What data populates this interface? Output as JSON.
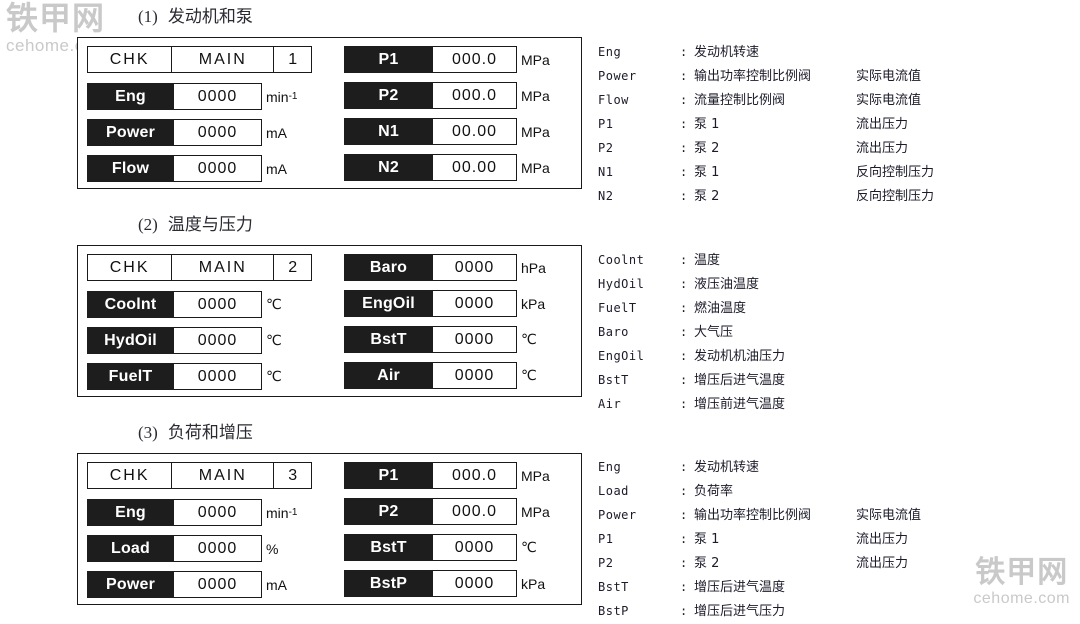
{
  "watermarks": {
    "top_left_cn": "铁甲网",
    "top_left_en": "cehome.com",
    "bottom_right_cn": "铁甲网",
    "bottom_right_en": "cehome.com"
  },
  "colors": {
    "label_background": "#1d1d1d",
    "label_text": "#ffffff",
    "panel_border": "#1a1a1a",
    "page_background": "#ffffff",
    "legend_text": "#1b1b2a",
    "watermark": "#c9c9c9"
  },
  "sections": [
    {
      "number": "(1)",
      "title": "发动机和泵",
      "panel": {
        "header": {
          "mode": "CHK",
          "menu": "MAIN",
          "page": "1"
        },
        "left_fields": [
          {
            "label": "Eng",
            "value": "0000",
            "unit": "min",
            "unit_sup": "-1"
          },
          {
            "label": "Power",
            "value": "0000",
            "unit": "mA",
            "unit_sup": ""
          },
          {
            "label": "Flow",
            "value": "0000",
            "unit": "mA",
            "unit_sup": ""
          }
        ],
        "right_fields": [
          {
            "label": "P1",
            "value": "000.0",
            "unit": "MPa",
            "unit_sup": ""
          },
          {
            "label": "P2",
            "value": "000.0",
            "unit": "MPa",
            "unit_sup": ""
          },
          {
            "label": "N1",
            "value": "00.00",
            "unit": "MPa",
            "unit_sup": ""
          },
          {
            "label": "N2",
            "value": "00.00",
            "unit": "MPa",
            "unit_sup": ""
          }
        ]
      },
      "legend": [
        {
          "key": "Eng",
          "colon": ":",
          "desc": "发动机转速",
          "extra": ""
        },
        {
          "key": "Power",
          "colon": ":",
          "desc": "输出功率控制比例阀",
          "extra": "实际电流值"
        },
        {
          "key": "Flow",
          "colon": ":",
          "desc": "流量控制比例阀",
          "extra": "实际电流值"
        },
        {
          "key": "P1",
          "colon": ":",
          "desc": "泵 1",
          "extra": "流出压力"
        },
        {
          "key": "P2",
          "colon": ":",
          "desc": "泵 2",
          "extra": "流出压力"
        },
        {
          "key": "N1",
          "colon": ":",
          "desc": "泵 1",
          "extra": "反向控制压力"
        },
        {
          "key": "N2",
          "colon": ":",
          "desc": "泵 2",
          "extra": "反向控制压力"
        }
      ]
    },
    {
      "number": "(2)",
      "title": "温度与压力",
      "panel": {
        "header": {
          "mode": "CHK",
          "menu": "MAIN",
          "page": "2"
        },
        "left_fields": [
          {
            "label": "Coolnt",
            "value": "0000",
            "unit": "℃",
            "unit_sup": ""
          },
          {
            "label": "HydOil",
            "value": "0000",
            "unit": "℃",
            "unit_sup": ""
          },
          {
            "label": "FuelT",
            "value": "0000",
            "unit": "℃",
            "unit_sup": ""
          }
        ],
        "right_fields": [
          {
            "label": "Baro",
            "value": "0000",
            "unit": "hPa",
            "unit_sup": ""
          },
          {
            "label": "EngOil",
            "value": "0000",
            "unit": "kPa",
            "unit_sup": ""
          },
          {
            "label": "BstT",
            "value": "0000",
            "unit": "℃",
            "unit_sup": ""
          },
          {
            "label": "Air",
            "value": "0000",
            "unit": "℃",
            "unit_sup": ""
          }
        ]
      },
      "legend": [
        {
          "key": "Coolnt",
          "colon": ":",
          "desc": "温度",
          "extra": ""
        },
        {
          "key": "HydOil",
          "colon": ":",
          "desc": "液压油温度",
          "extra": ""
        },
        {
          "key": "FuelT",
          "colon": ":",
          "desc": "燃油温度",
          "extra": ""
        },
        {
          "key": "Baro",
          "colon": ":",
          "desc": "大气压",
          "extra": ""
        },
        {
          "key": "EngOil",
          "colon": ":",
          "desc": "发动机机油压力",
          "extra": ""
        },
        {
          "key": "BstT",
          "colon": ":",
          "desc": "增压后进气温度",
          "extra": ""
        },
        {
          "key": "Air",
          "colon": ":",
          "desc": "增压前进气温度",
          "extra": ""
        }
      ]
    },
    {
      "number": "(3)",
      "title": "负荷和增压",
      "panel": {
        "header": {
          "mode": "CHK",
          "menu": "MAIN",
          "page": "3"
        },
        "left_fields": [
          {
            "label": "Eng",
            "value": "0000",
            "unit": "min",
            "unit_sup": "-1"
          },
          {
            "label": "Load",
            "value": "0000",
            "unit": "%",
            "unit_sup": ""
          },
          {
            "label": "Power",
            "value": "0000",
            "unit": "mA",
            "unit_sup": ""
          }
        ],
        "right_fields": [
          {
            "label": "P1",
            "value": "000.0",
            "unit": "MPa",
            "unit_sup": ""
          },
          {
            "label": "P2",
            "value": "000.0",
            "unit": "MPa",
            "unit_sup": ""
          },
          {
            "label": "BstT",
            "value": "0000",
            "unit": "℃",
            "unit_sup": ""
          },
          {
            "label": "BstP",
            "value": "0000",
            "unit": "kPa",
            "unit_sup": ""
          }
        ]
      },
      "legend": [
        {
          "key": "Eng",
          "colon": ":",
          "desc": "发动机转速",
          "extra": ""
        },
        {
          "key": "Load",
          "colon": ":",
          "desc": "负荷率",
          "extra": ""
        },
        {
          "key": "Power",
          "colon": ":",
          "desc": "输出功率控制比例阀",
          "extra": "实际电流值"
        },
        {
          "key": "P1",
          "colon": ":",
          "desc": "泵 1",
          "extra": "流出压力"
        },
        {
          "key": "P2",
          "colon": ":",
          "desc": "泵 2",
          "extra": "流出压力"
        },
        {
          "key": "BstT",
          "colon": ":",
          "desc": "增压后进气温度",
          "extra": ""
        },
        {
          "key": "BstP",
          "colon": ":",
          "desc": "增压后进气压力",
          "extra": ""
        }
      ]
    }
  ]
}
